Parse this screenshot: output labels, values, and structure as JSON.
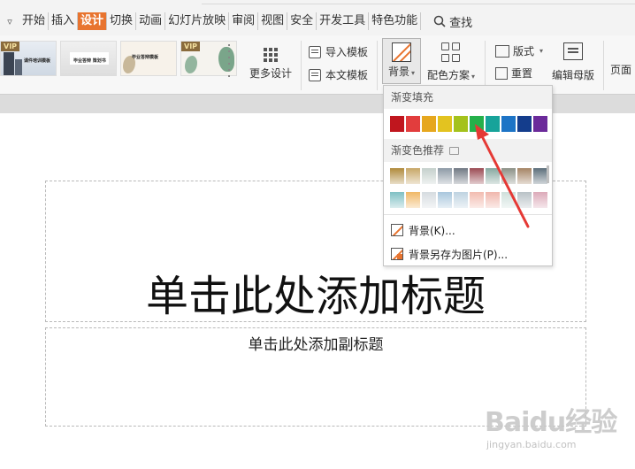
{
  "menu": {
    "toggle": "▿",
    "items": [
      "开始",
      "插入",
      "设计",
      "切换",
      "动画",
      "幻灯片放映",
      "审阅",
      "视图",
      "安全",
      "开发工具",
      "特色功能"
    ],
    "active_index": 2,
    "search_label": "查找"
  },
  "ribbon": {
    "templates": [
      {
        "vip": "VIP",
        "text": "课件培训模板"
      },
      {
        "vip": "",
        "text": "毕业答辩 策划书"
      },
      {
        "vip": "",
        "text": "毕业答辩模板"
      },
      {
        "vip": "VIP",
        "text": ""
      }
    ],
    "more_design": "更多设计",
    "import_template": "导入模板",
    "this_template": "本文模板",
    "background": "背景",
    "color_scheme": "配色方案",
    "layout": "版式",
    "reset": "重置",
    "master": "编辑母版",
    "page": "页面"
  },
  "dropdown": {
    "gradient_fill_title": "渐变填充",
    "gradient_fill_colors": [
      "#c0161e",
      "#e23d3d",
      "#e6a71e",
      "#e3c320",
      "#a4c21c",
      "#25b04a",
      "#17a39a",
      "#1d74c6",
      "#143d8c",
      "#6b2a9a"
    ],
    "recommended_title": "渐变色推荐",
    "recommended_row1": [
      "#b08a3c",
      "#c7a767",
      "#c5d0cc",
      "#8d9aa6",
      "#707883",
      "#9b4b54",
      "#86a8a0",
      "#8b9086",
      "#a58465",
      "#5c6e7a"
    ],
    "recommended_row2": [
      "#7fc0c4",
      "#f0b866",
      "#d6dce0",
      "#a9c7dd",
      "#bfd3e1",
      "#f2bcb0",
      "#f0b7ad",
      "#cfe0dc",
      "#b9c2c7",
      "#dcaab9"
    ],
    "item_background": "背景(K)...",
    "item_save_as_image": "背景另存为图片(P)..."
  },
  "slide": {
    "title_placeholder": "单击此处添加标题",
    "subtitle_placeholder": "单击此处添加副标题"
  },
  "watermark": {
    "brand": "Baidu经验",
    "url": "jingyan.baidu.com"
  },
  "colors": {
    "active_tab": "#e8742f",
    "annotation_arrow": "#e53935"
  }
}
